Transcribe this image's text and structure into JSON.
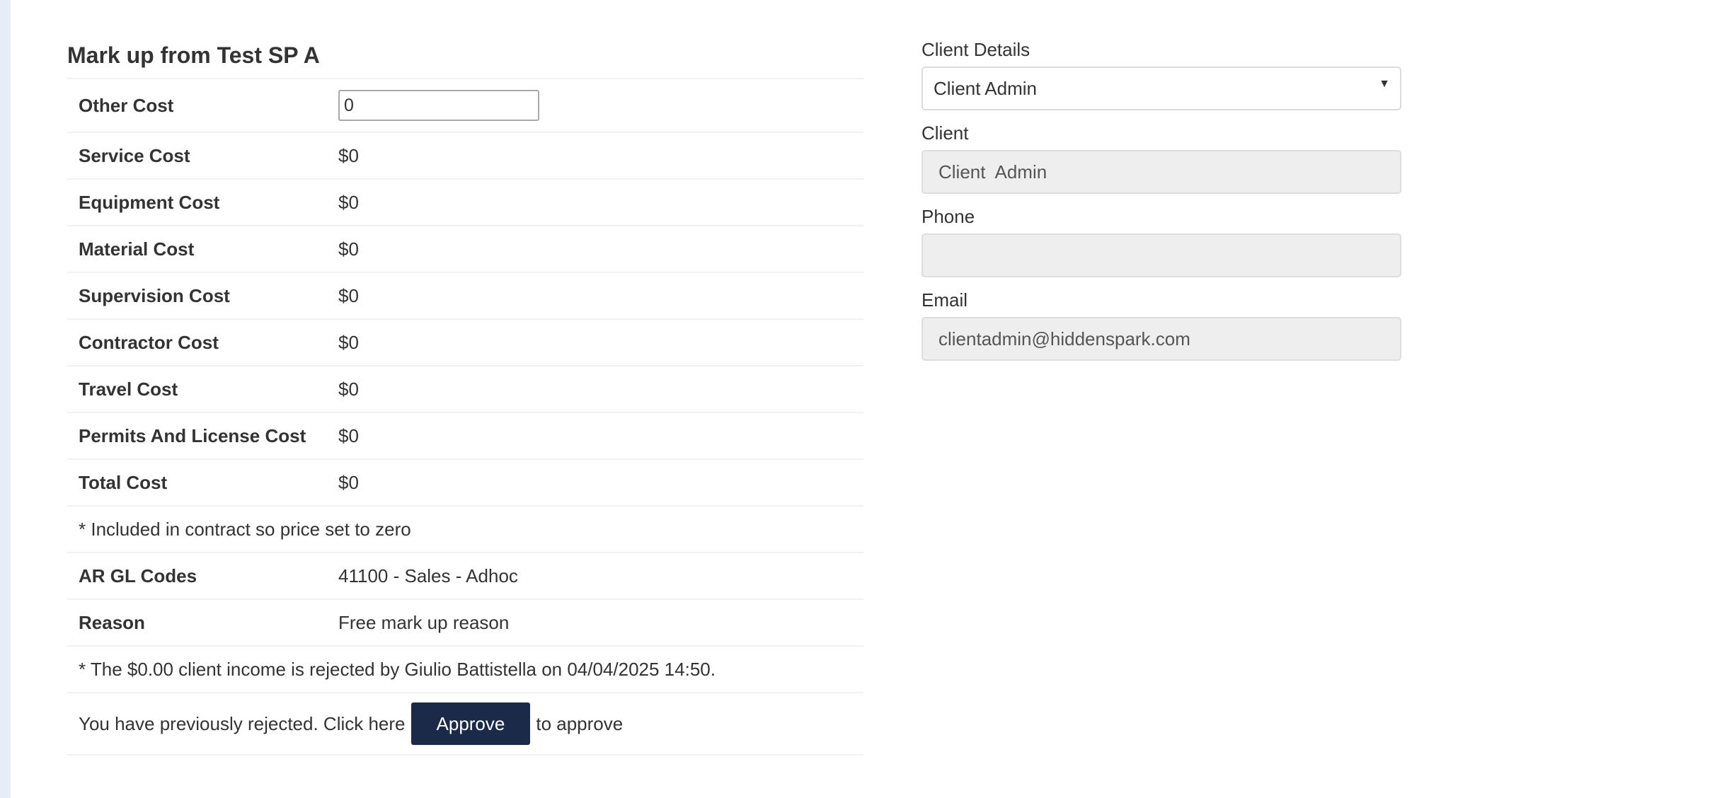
{
  "markup": {
    "title": "Mark up from Test SP A",
    "other_cost": {
      "label": "Other Cost",
      "value": "0"
    },
    "costs": [
      {
        "label": "Service Cost",
        "value": "$0"
      },
      {
        "label": "Equipment Cost",
        "value": "$0"
      },
      {
        "label": "Material Cost",
        "value": "$0"
      },
      {
        "label": "Supervision Cost",
        "value": "$0"
      },
      {
        "label": "Contractor Cost",
        "value": "$0"
      },
      {
        "label": "Travel Cost",
        "value": "$0"
      },
      {
        "label": "Permits And License Cost",
        "value": "$0"
      },
      {
        "label": "Total Cost",
        "value": "$0"
      }
    ],
    "contract_note": "* Included in contract so price set to zero",
    "ar_gl": {
      "label": "AR GL Codes",
      "value": "41100 - Sales - Adhoc"
    },
    "reason": {
      "label": "Reason",
      "value": "Free mark up reason"
    },
    "rejection_note": "* The $0.00 client income is rejected by Giulio Battistella on 04/04/2025 14:50.",
    "approve": {
      "prefix": "You have previously rejected. Click here",
      "button_label": "Approve",
      "suffix": "to approve"
    }
  },
  "client": {
    "details_label": "Client Details",
    "details_selected": "Client Admin",
    "client_label": "Client",
    "client_value": "Client  Admin",
    "phone_label": "Phone",
    "phone_value": "",
    "email_label": "Email",
    "email_value": "clientadmin@hiddenspark.com"
  },
  "colors": {
    "button_bg": "#1c2a4a",
    "readonly_bg": "#eeeeee",
    "left_strip": "#e8ecf6"
  }
}
